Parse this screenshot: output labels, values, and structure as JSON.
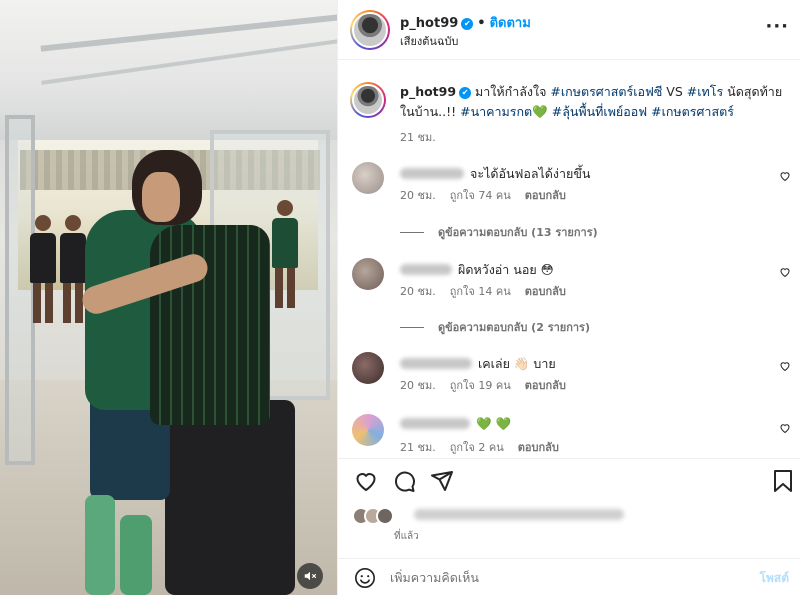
{
  "post": {
    "username": "p_hot99",
    "follow_label": "ติดตาม",
    "audio_label": "เสียงต้นฉบับ",
    "more_label": "···",
    "caption_prefix": "มาให้กำลังใจ ",
    "caption_tag1": "#เกษตรศาสตร์เอฟซี",
    "caption_mid": " VS ",
    "caption_tag2": "#เทโร",
    "caption_mid2": " นัดสุดท้ายในบ้าน..!! ",
    "caption_tag3": "#นาคามรกต",
    "caption_emoji": "💚",
    "caption_tag4": "#ลุ้นพื้นที่เพย์ออฟ",
    "caption_tag5": "#เกษตรศาสตร์",
    "caption_time": "21 ชม."
  },
  "comments": [
    {
      "text": "จะได้อันฟอลได้ง่ายขึ้น",
      "time": "20 ชม.",
      "likes": "ถูกใจ 74 คน",
      "reply_label": "ตอบกลับ",
      "view_replies": "ดูข้อความตอบกลับ (13 รายการ)"
    },
    {
      "text": "ผิดหวังอ่า นอย 😳",
      "time": "20 ชม.",
      "likes": "ถูกใจ 14 คน",
      "reply_label": "ตอบกลับ",
      "view_replies": "ดูข้อความตอบกลับ (2 รายการ)"
    },
    {
      "text": "เคเล่ย 👋🏻 บาย",
      "time": "20 ชม.",
      "likes": "ถูกใจ 19 คน",
      "reply_label": "ตอบกลับ"
    },
    {
      "text": "💚 💚",
      "time": "21 ชม.",
      "likes": "ถูกใจ 2 คน",
      "reply_label": "ตอบกลับ"
    }
  ],
  "liked_by_time": "ที่แล้ว",
  "add_comment": {
    "placeholder": "เพิ่มความคิดเห็น",
    "post_label": "โพสต์"
  },
  "icons": {
    "verified": "verified-badge-icon",
    "heart": "heart-icon",
    "comment": "comment-icon",
    "share": "paper-plane-icon",
    "save": "bookmark-icon",
    "emoji": "emoji-icon",
    "mute": "speaker-muted-icon"
  },
  "colors": {
    "accent": "#0095f6",
    "hashtag": "#00376b",
    "muted_text": "#737373",
    "green_heart": "#22c55e"
  }
}
